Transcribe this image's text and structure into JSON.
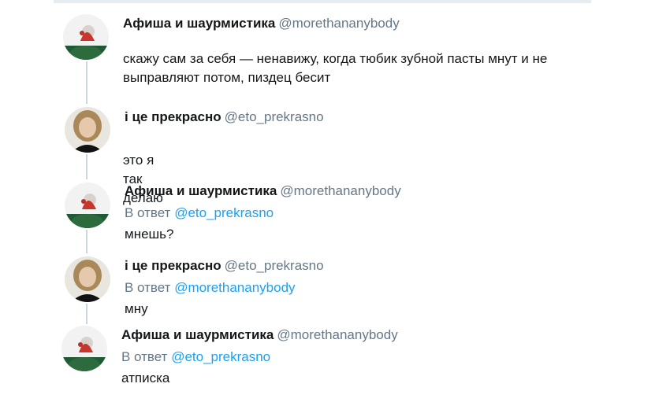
{
  "tweets": [
    {
      "author": "Афиша и шаурмистика",
      "handle": "@morethananybody",
      "text_lines": [
        "скажу сам за себя — ненавижу, когда тюбик зубной пасты мнут и не",
        "выправляют потом, пиздец бесит"
      ]
    },
    {
      "author": "і це прекрасно",
      "handle": "@eto_prekrasno",
      "text": "это я так делаю"
    },
    {
      "author": "Афиша и шаурмистика",
      "handle": "@morethananybody",
      "reply_prefix": "В ответ",
      "reply_to": "@eto_prekrasno",
      "text": "мнешь?"
    },
    {
      "author": "і це прекрасно",
      "handle": "@eto_prekrasno",
      "reply_prefix": "В ответ",
      "reply_to": "@morethananybody",
      "text": "мну"
    },
    {
      "author": "Афиша и шаурмистика",
      "handle": "@morethananybody",
      "reply_prefix": "В ответ",
      "reply_to": "@eto_prekrasno",
      "text": "атписка"
    }
  ],
  "colors": {
    "text": "#14171a",
    "secondary": "#657786",
    "link": "#1da1f2",
    "thread_line": "#ccd6dd"
  }
}
